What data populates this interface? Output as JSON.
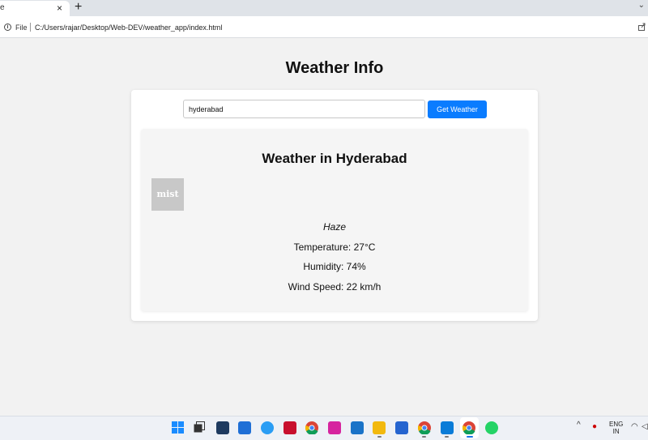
{
  "browser": {
    "tab_partial_label": "e",
    "tab_close": "×",
    "new_tab": "+",
    "tabs_menu": "⌄",
    "file_label": "File",
    "url": "C:/Users/rajar/Desktop/Web-DEV/weather_app/index.html"
  },
  "page": {
    "title": "Weather Info",
    "search": {
      "value": "hyderabad"
    },
    "button_label": "Get Weather",
    "result": {
      "title": "Weather in Hyderabad",
      "icon_text": "mist",
      "description": "Haze",
      "temperature": "Temperature: 27°C",
      "humidity": "Humidity: 74%",
      "wind": "Wind Speed: 22 km/h"
    }
  },
  "taskbar": {
    "icons": [
      "windows-start-icon",
      "task-view-icon",
      "store-icon",
      "mcafee-icon",
      "edge-icon",
      "security-icon",
      "chrome-icon",
      "instagram-icon",
      "devices-icon",
      "file-explorer-icon",
      "todo-icon",
      "chrome-badge-icon",
      "vscode-icon",
      "chrome-active-icon",
      "whatsapp-icon"
    ],
    "lang_line1": "ENG",
    "lang_line2": "IN",
    "tray_caret": "^"
  },
  "colors": {
    "accent": "#0a7cff",
    "page_bg": "#f2f2f2",
    "card_bg": "#ffffff",
    "result_bg": "#f5f5f5"
  }
}
